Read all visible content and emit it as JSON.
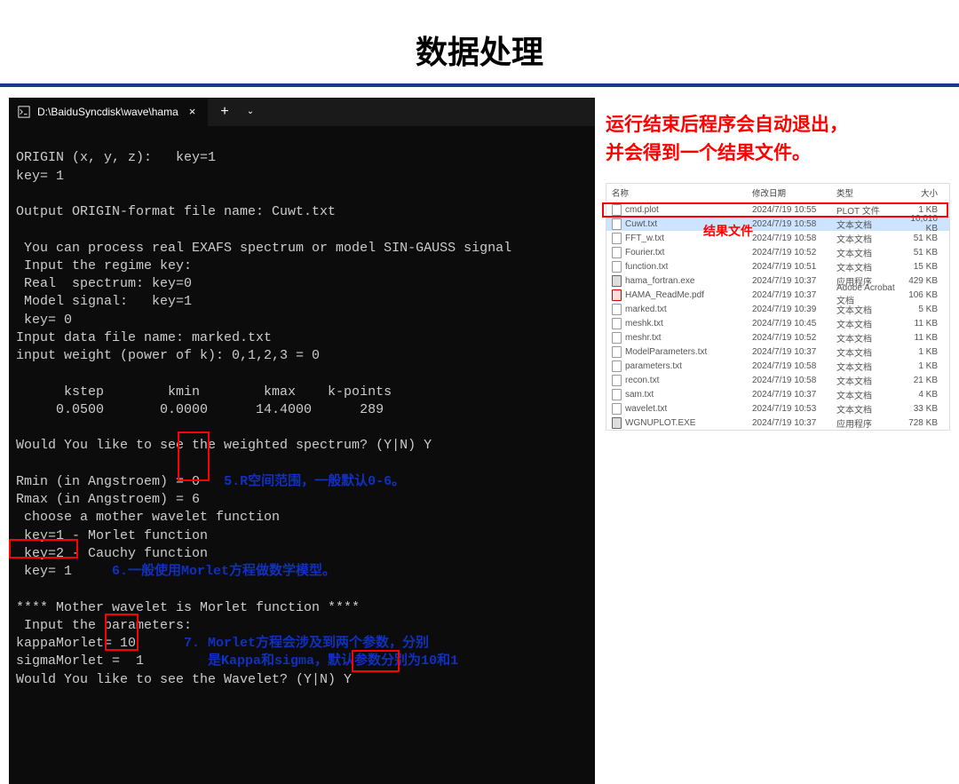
{
  "title": "数据处理",
  "terminal": {
    "tab_title": "D:\\BaiduSyncdisk\\wave\\hama",
    "lines": [
      "ORIGIN (x, y, z):   key=1",
      "key= 1",
      "",
      "Output ORIGIN-format file name: Cuwt.txt",
      "",
      " You can process real EXAFS spectrum or model SIN-GAUSS signal",
      " Input the regime key:",
      " Real  spectrum: key=0",
      " Model signal:   key=1",
      " key= 0",
      "Input data file name: marked.txt",
      "input weight (power of k): 0,1,2,3 = 0",
      "",
      "      kstep        kmin        kmax    k-points",
      "     0.0500       0.0000      14.4000      289",
      "",
      "Would You like to see the weighted spectrum? (Y|N) Y",
      "",
      "Rmin (in Angstroem) = 0",
      "Rmax (in Angstroem) = 6",
      " choose a mother wavelet function",
      " key=1 - Morlet function",
      " key=2 - Cauchy function",
      " key= 1",
      "",
      "**** Mother wavelet is Morlet function ****",
      " Input the parameters:",
      "kappaMorlet= 10",
      "sigmaMorlet =  1",
      "Would You like to see the Wavelet? (Y|N) Y"
    ],
    "annot5": "5.R空间范围，一般默认0-6。",
    "annot6": "6.一般使用Morlet方程做数学模型。",
    "annot7a": "7. Morlet方程会涉及到两个参数，分别",
    "annot7b": "是Kappa和sigma，默认参数分别为10和1"
  },
  "right": {
    "red_note_1": "运行结束后程序会自动退出，",
    "red_note_2": "并会得到一个结果文件。",
    "result_label": "结果文件",
    "file_headers": {
      "name": "名称",
      "date": "修改日期",
      "type": "类型",
      "size": "大小"
    },
    "files": [
      {
        "icon": "txt",
        "name": "cmd.plot",
        "date": "2024/7/19 10:55",
        "type": "PLOT 文件",
        "size": "1 KB"
      },
      {
        "icon": "txt",
        "name": "Cuwt.txt",
        "date": "2024/7/19 10:58",
        "type": "文本文档",
        "size": "10,010 KB",
        "sel": true
      },
      {
        "icon": "txt",
        "name": "FFT_w.txt",
        "date": "2024/7/19 10:58",
        "type": "文本文档",
        "size": "51 KB"
      },
      {
        "icon": "txt",
        "name": "Fourier.txt",
        "date": "2024/7/19 10:52",
        "type": "文本文档",
        "size": "51 KB"
      },
      {
        "icon": "txt",
        "name": "function.txt",
        "date": "2024/7/19 10:51",
        "type": "文本文档",
        "size": "15 KB"
      },
      {
        "icon": "exe",
        "name": "hama_fortran.exe",
        "date": "2024/7/19 10:37",
        "type": "应用程序",
        "size": "429 KB"
      },
      {
        "icon": "pdf",
        "name": "HAMA_ReadMe.pdf",
        "date": "2024/7/19 10:37",
        "type": "Adobe Acrobat 文档",
        "size": "106 KB"
      },
      {
        "icon": "txt",
        "name": "marked.txt",
        "date": "2024/7/19 10:39",
        "type": "文本文档",
        "size": "5 KB"
      },
      {
        "icon": "txt",
        "name": "meshk.txt",
        "date": "2024/7/19 10:45",
        "type": "文本文档",
        "size": "11 KB"
      },
      {
        "icon": "txt",
        "name": "meshr.txt",
        "date": "2024/7/19 10:52",
        "type": "文本文档",
        "size": "11 KB"
      },
      {
        "icon": "txt",
        "name": "ModelParameters.txt",
        "date": "2024/7/19 10:37",
        "type": "文本文档",
        "size": "1 KB"
      },
      {
        "icon": "txt",
        "name": "parameters.txt",
        "date": "2024/7/19 10:58",
        "type": "文本文档",
        "size": "1 KB"
      },
      {
        "icon": "txt",
        "name": "recon.txt",
        "date": "2024/7/19 10:58",
        "type": "文本文档",
        "size": "21 KB"
      },
      {
        "icon": "txt",
        "name": "sam.txt",
        "date": "2024/7/19 10:37",
        "type": "文本文档",
        "size": "4 KB"
      },
      {
        "icon": "txt",
        "name": "wavelet.txt",
        "date": "2024/7/19 10:53",
        "type": "文本文档",
        "size": "33 KB"
      },
      {
        "icon": "exe",
        "name": "WGNUPLOT.EXE",
        "date": "2024/7/19 10:37",
        "type": "应用程序",
        "size": "728 KB"
      }
    ]
  }
}
